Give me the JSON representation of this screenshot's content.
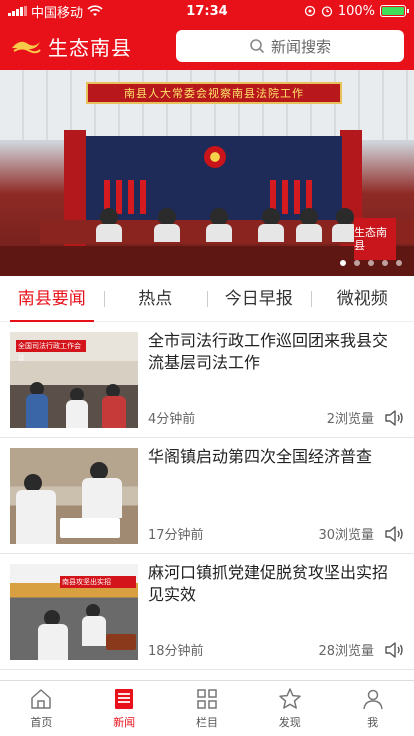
{
  "status_bar": {
    "carrier": "中国移动",
    "time": "17:34",
    "battery": "100%"
  },
  "header": {
    "app_title": "生态南县",
    "search_placeholder": "新闻搜索"
  },
  "banner": {
    "sign_text": "南县人大常委会视察南县法院工作",
    "stamp_text": "生态南县",
    "slides_count": 5,
    "active_slide": 0
  },
  "tabs": [
    {
      "label": "南县要闻",
      "active": true
    },
    {
      "label": "热点",
      "active": false
    },
    {
      "label": "今日早报",
      "active": false
    },
    {
      "label": "微视频",
      "active": false
    }
  ],
  "news": [
    {
      "title": "全市司法行政工作巡回团来我县交流基层司法工作",
      "time": "4分钟前",
      "views": "2浏览量",
      "thumb_banner": "全国司法行政工作会议"
    },
    {
      "title": "华阁镇启动第四次全国经济普查",
      "time": "17分钟前",
      "views": "30浏览量",
      "thumb_banner": ""
    },
    {
      "title": "麻河口镇抓党建促脱贫攻坚出实招见实效",
      "time": "18分钟前",
      "views": "28浏览量",
      "thumb_banner": "南县攻坚出实招"
    }
  ],
  "tabbar": [
    {
      "label": "首页",
      "icon": "home-icon",
      "active": false
    },
    {
      "label": "新闻",
      "icon": "news-icon",
      "active": true
    },
    {
      "label": "栏目",
      "icon": "grid-icon",
      "active": false
    },
    {
      "label": "发现",
      "icon": "star-icon",
      "active": false
    },
    {
      "label": "我",
      "icon": "person-icon",
      "active": false
    }
  ],
  "colors": {
    "brand_red": "#e8111a",
    "text": "#222222",
    "meta": "#666666"
  }
}
